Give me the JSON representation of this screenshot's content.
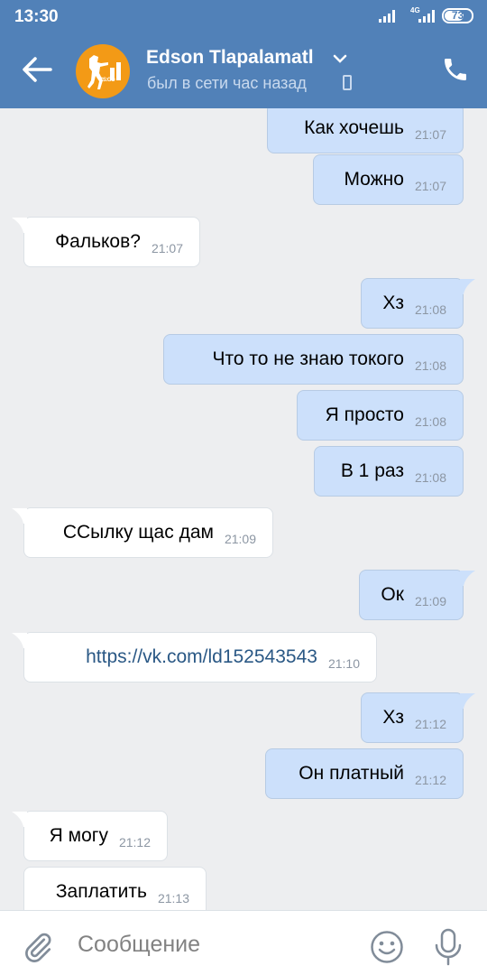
{
  "statusbar": {
    "time": "13:30",
    "network": "4G",
    "battery": "73",
    "battery_level": 0.73
  },
  "header": {
    "name": "Edson Tlapalamatl",
    "status": "был в сети час назад",
    "avatar_text": "CS:GO"
  },
  "messages": [
    {
      "dir": "out",
      "text": "Как хочешь",
      "time": "21:07"
    },
    {
      "dir": "out",
      "text": "Можно",
      "time": "21:07"
    },
    {
      "dir": "in",
      "text": "Фальков?",
      "time": "21:07"
    },
    {
      "dir": "out",
      "text": "Хз",
      "time": "21:08"
    },
    {
      "dir": "out",
      "text": "Что то не знаю токого",
      "time": "21:08"
    },
    {
      "dir": "out",
      "text": "Я просто",
      "time": "21:08"
    },
    {
      "dir": "out",
      "text": "В 1 раз",
      "time": "21:08"
    },
    {
      "dir": "in",
      "text": "ССылку щас дам",
      "time": "21:09"
    },
    {
      "dir": "out",
      "text": "Ок",
      "time": "21:09"
    },
    {
      "dir": "in",
      "text": "https://vk.com/ld152543543",
      "time": "21:10"
    },
    {
      "dir": "out",
      "text": "Хз",
      "time": "21:12"
    },
    {
      "dir": "out",
      "text": "Он платный",
      "time": "21:12"
    },
    {
      "dir": "in",
      "text": "Я могу",
      "time": "21:12"
    },
    {
      "dir": "in",
      "text": "Заплатить",
      "time": "21:13"
    }
  ],
  "composer": {
    "placeholder": "Сообщение"
  },
  "colors": {
    "header": "#5181b8",
    "outgoing": "#cce0fb",
    "incoming": "#ffffff",
    "background": "#edeef0",
    "avatar": "#f39a16"
  },
  "icons": [
    "back-arrow-icon",
    "chevron-down-icon",
    "phone-icon",
    "call-icon",
    "paperclip-icon",
    "smile-icon",
    "microphone-icon"
  ]
}
